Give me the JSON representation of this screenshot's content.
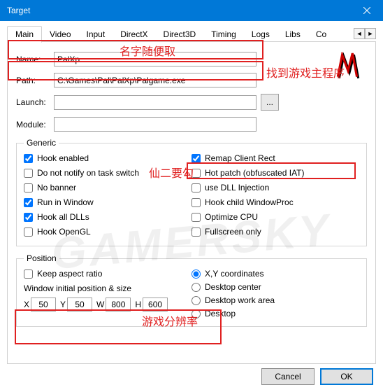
{
  "window": {
    "title": "Target"
  },
  "tabs": [
    "Main",
    "Video",
    "Input",
    "DirectX",
    "Direct3D",
    "Timing",
    "Logs",
    "Libs",
    "Co"
  ],
  "fields": {
    "name_label": "Name:",
    "name_value": "PalXp",
    "path_label": "Path:",
    "path_value": "C:\\Games\\Pal\\PalXp\\Palgame.exe",
    "launch_label": "Launch:",
    "launch_value": "",
    "module_label": "Module:",
    "module_value": "",
    "browse": "..."
  },
  "generic": {
    "legend": "Generic",
    "left": [
      "Hook enabled",
      "Do not notify on task switch",
      "No banner",
      "Run in Window",
      "Hook all DLLs",
      "Hook OpenGL"
    ],
    "left_checked": [
      true,
      false,
      false,
      true,
      true,
      false
    ],
    "right": [
      "Remap Client Rect",
      "Hot patch (obfuscated IAT)",
      "use DLL Injection",
      "Hook child WindowProc",
      "Optimize CPU",
      "Fullscreen only"
    ],
    "right_checked": [
      true,
      false,
      false,
      false,
      false,
      false
    ]
  },
  "position": {
    "legend": "Position",
    "keep_aspect": "Keep aspect ratio",
    "wips": "Window initial position & size",
    "x": "X",
    "y": "Y",
    "w": "W",
    "h": "H",
    "xv": "50",
    "yv": "50",
    "wv": "800",
    "hv": "600",
    "radios": [
      "X,Y coordinates",
      "Desktop center",
      "Desktop work area",
      "Desktop"
    ],
    "radio_sel": 0
  },
  "buttons": {
    "cancel": "Cancel",
    "ok": "OK"
  },
  "annotations": {
    "a1": "名字随便取",
    "a2": "找到游戏主程序",
    "a3": "仙二要勾",
    "a4": "游戏分辨率"
  },
  "watermark": "GAMERSKY"
}
